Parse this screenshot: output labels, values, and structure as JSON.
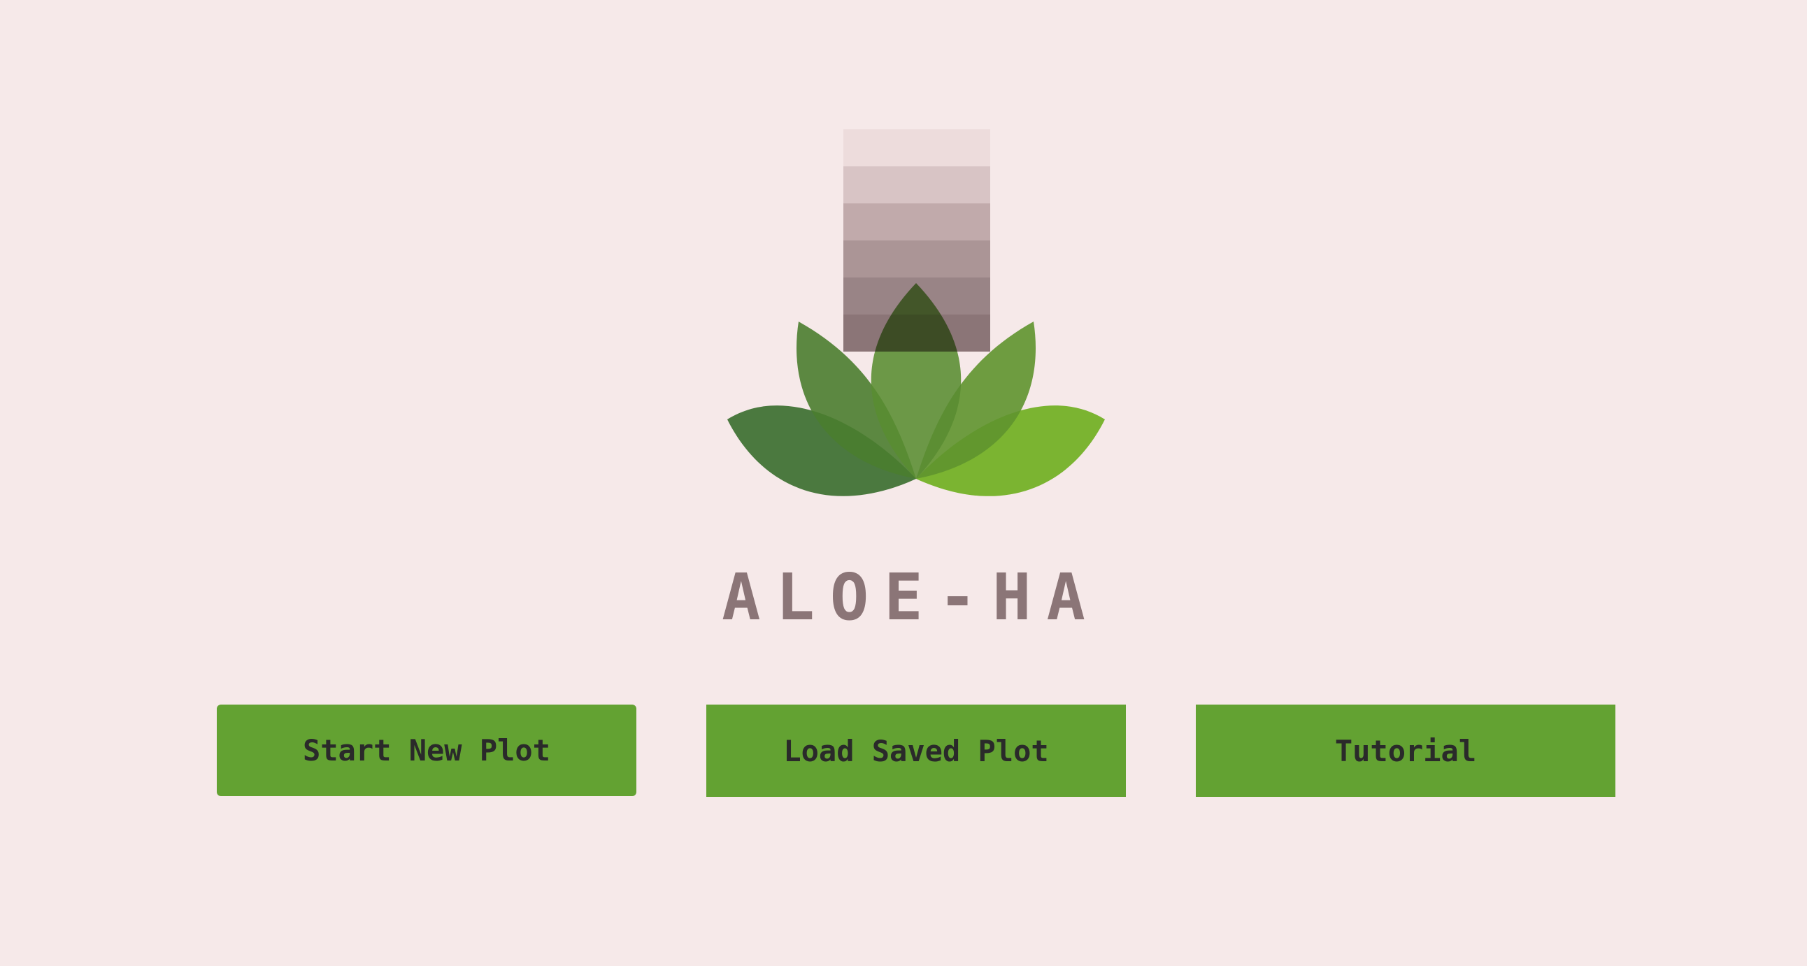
{
  "app": {
    "title": "ALOE-HA"
  },
  "buttons": {
    "start_new_plot": "Start New Plot",
    "load_saved_plot": "Load Saved Plot",
    "tutorial": "Tutorial"
  },
  "colors": {
    "background": "#f6e9e9",
    "button": "#63a232",
    "button_text": "#2a2a2a",
    "title_text": "#8b7577",
    "leaf_dark": "#3f7a35",
    "leaf_mid": "#5f9d35",
    "leaf_light": "#78c22a"
  },
  "icons": {
    "logo": "aloe-leaves-logo-icon"
  }
}
